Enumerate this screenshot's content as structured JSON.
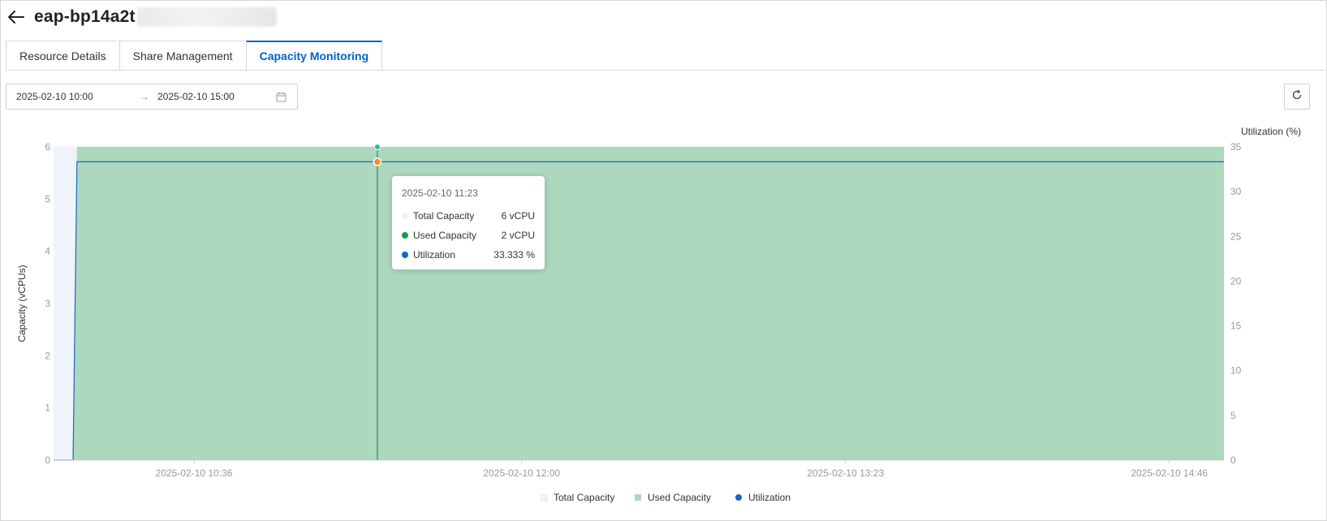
{
  "header": {
    "back_icon": "arrow-left-icon",
    "title": "eap-bp14a2t"
  },
  "tabs": [
    {
      "label": "Resource Details",
      "active": false
    },
    {
      "label": "Share Management",
      "active": false
    },
    {
      "label": "Capacity Monitoring",
      "active": true
    }
  ],
  "date_range": {
    "start": "2025-02-10 10:00",
    "separator": "→",
    "end": "2025-02-10 15:00",
    "icon": "calendar-icon"
  },
  "refresh": {
    "icon": "refresh-icon"
  },
  "colors": {
    "accent": "#0064c8",
    "total_capacity": "#eef4fa",
    "used_capacity": "#acd8bd",
    "used_capacity_dot": "#1a9b4b",
    "utilization": "#1767c4",
    "axis_text": "#999999"
  },
  "tooltip": {
    "time": "2025-02-10 11:23",
    "rows": [
      {
        "name": "Total Capacity",
        "value": "6 vCPU"
      },
      {
        "name": "Used Capacity",
        "value": "2 vCPU"
      },
      {
        "name": "Utilization",
        "value": "33.333 %"
      }
    ]
  },
  "chart_data": {
    "type": "area",
    "title": "",
    "x_ticks": [
      "2025-02-10 10:36",
      "2025-02-10 12:00",
      "2025-02-10 13:23",
      "2025-02-10 14:46"
    ],
    "x_range": [
      "2025-02-10 10:00",
      "2025-02-10 15:00"
    ],
    "y_left": {
      "label": "Capacity (vCPUs)",
      "range": [
        0,
        6
      ],
      "ticks": [
        0,
        1,
        2,
        3,
        4,
        5,
        6
      ]
    },
    "y_right": {
      "label": "Utilization (%)",
      "range": [
        0,
        35
      ],
      "ticks": [
        0,
        5,
        10,
        15,
        20,
        25,
        30,
        35
      ]
    },
    "series": [
      {
        "name": "Total Capacity",
        "axis": "left",
        "type": "area",
        "points": [
          [
            "2025-02-10 10:00",
            6
          ],
          [
            "2025-02-10 15:00",
            6
          ]
        ]
      },
      {
        "name": "Used Capacity",
        "axis": "left",
        "type": "area",
        "points": [
          [
            "2025-02-10 10:00",
            0
          ],
          [
            "2025-02-10 10:05",
            0
          ],
          [
            "2025-02-10 10:06",
            6
          ],
          [
            "2025-02-10 15:00",
            6
          ]
        ]
      },
      {
        "name": "Utilization",
        "axis": "right",
        "type": "line",
        "points": [
          [
            "2025-02-10 10:00",
            0
          ],
          [
            "2025-02-10 10:05",
            0
          ],
          [
            "2025-02-10 10:06",
            33.333
          ],
          [
            "2025-02-10 15:00",
            33.333
          ]
        ]
      }
    ],
    "hover": {
      "x": "2025-02-10 11:23",
      "used": 6,
      "utilization": 33.333
    },
    "grid": true,
    "legend": {
      "position": "bottom-center",
      "items": [
        "Total Capacity",
        "Used Capacity",
        "Utilization"
      ]
    }
  }
}
